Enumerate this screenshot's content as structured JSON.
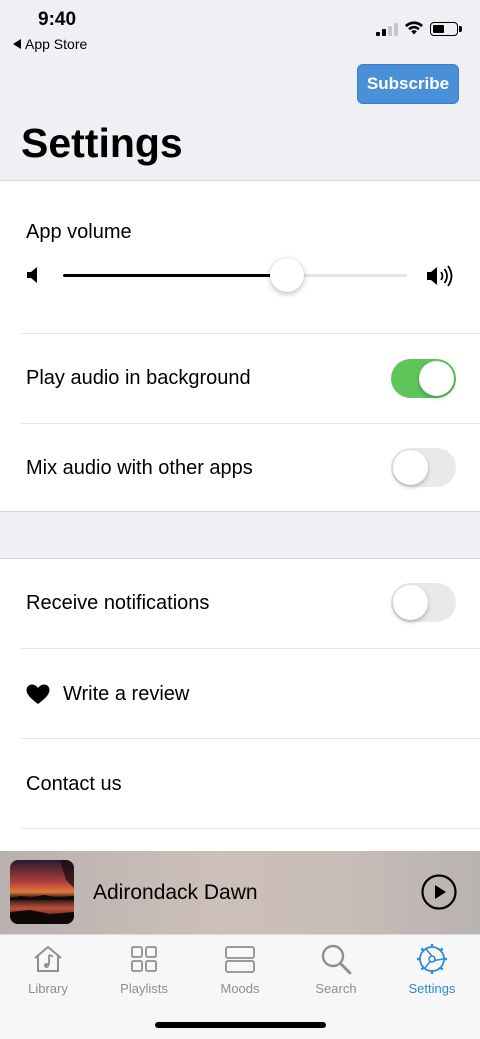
{
  "status": {
    "time": "9:40",
    "back_app": "App Store"
  },
  "header": {
    "subscribe_label": "Subscribe",
    "title": "Settings"
  },
  "audio": {
    "volume_label": "App volume",
    "volume_level": 0.65,
    "play_background_label": "Play audio in background",
    "play_background_on": true,
    "mix_audio_label": "Mix audio with other apps",
    "mix_audio_on": false
  },
  "other": {
    "notifications_label": "Receive notifications",
    "notifications_on": false,
    "review_label": "Write a review",
    "review_icon": "heart-icon",
    "contact_label": "Contact us"
  },
  "now_playing": {
    "title": "Adirondack Dawn",
    "play_icon": "play-circle-icon"
  },
  "tabs": [
    {
      "label": "Library",
      "icon": "house-music-icon",
      "active": false
    },
    {
      "label": "Playlists",
      "icon": "grid-icon",
      "active": false
    },
    {
      "label": "Moods",
      "icon": "stack-icon",
      "active": false
    },
    {
      "label": "Search",
      "icon": "search-icon",
      "active": false
    },
    {
      "label": "Settings",
      "icon": "gear-icon",
      "active": true
    }
  ],
  "colors": {
    "accent": "#2f8ad8",
    "subscribe_bg": "#4a90d9",
    "toggle_on": "#5ec55a",
    "toggle_off": "#e9e9eb"
  }
}
